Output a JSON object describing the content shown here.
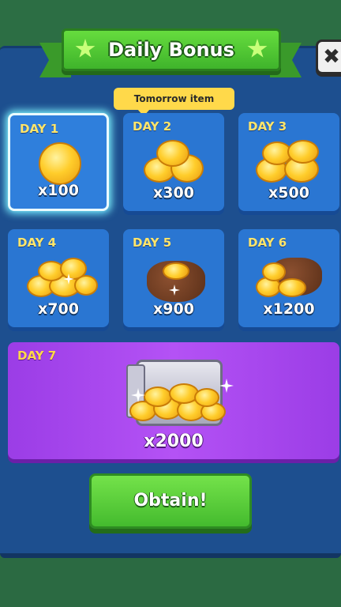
{
  "header": {
    "title": "Daily Bonus",
    "close_label": "✖"
  },
  "tomorrow_tag": "Tomorrow item",
  "days": [
    {
      "day": "DAY 1",
      "amount": "x100",
      "reward_icon": "coin-icon"
    },
    {
      "day": "DAY 2",
      "amount": "x300",
      "reward_icon": "coin-stack-icon"
    },
    {
      "day": "DAY 3",
      "amount": "x500",
      "reward_icon": "coin-pile-icon"
    },
    {
      "day": "DAY 4",
      "amount": "x700",
      "reward_icon": "coin-heap-icon"
    },
    {
      "day": "DAY 5",
      "amount": "x900",
      "reward_icon": "coin-pouch-icon"
    },
    {
      "day": "DAY 6",
      "amount": "x1200",
      "reward_icon": "coin-sack-icon"
    },
    {
      "day": "DAY 7",
      "amount": "x2000",
      "reward_icon": "treasure-safe-icon"
    }
  ],
  "obtain_label": "Obtain!",
  "colors": {
    "panel": "#1d4f8f",
    "tile": "#2a76d2",
    "day7_tile": "#b452f5",
    "banner": "#4fc834",
    "accent_yellow": "#ffe56b",
    "obtain_button": "#5ccf3a"
  }
}
